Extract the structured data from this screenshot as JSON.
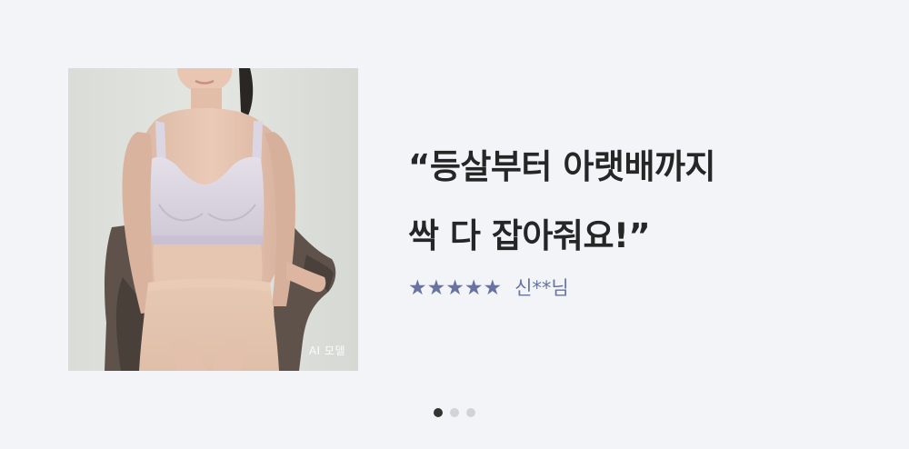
{
  "review": {
    "quote_line1": "“등살부터 아랫배까지",
    "quote_line2": "싹 다 잡아줘요!”",
    "stars": "★★★★★",
    "rating": 5,
    "reviewer": "신**님",
    "photo_tag": "AI 모델",
    "accent_color": "#6873a0"
  },
  "pagination": {
    "total": 3,
    "active_index": 0,
    "active_color": "#333333",
    "inactive_color": "#d3d3d6"
  }
}
